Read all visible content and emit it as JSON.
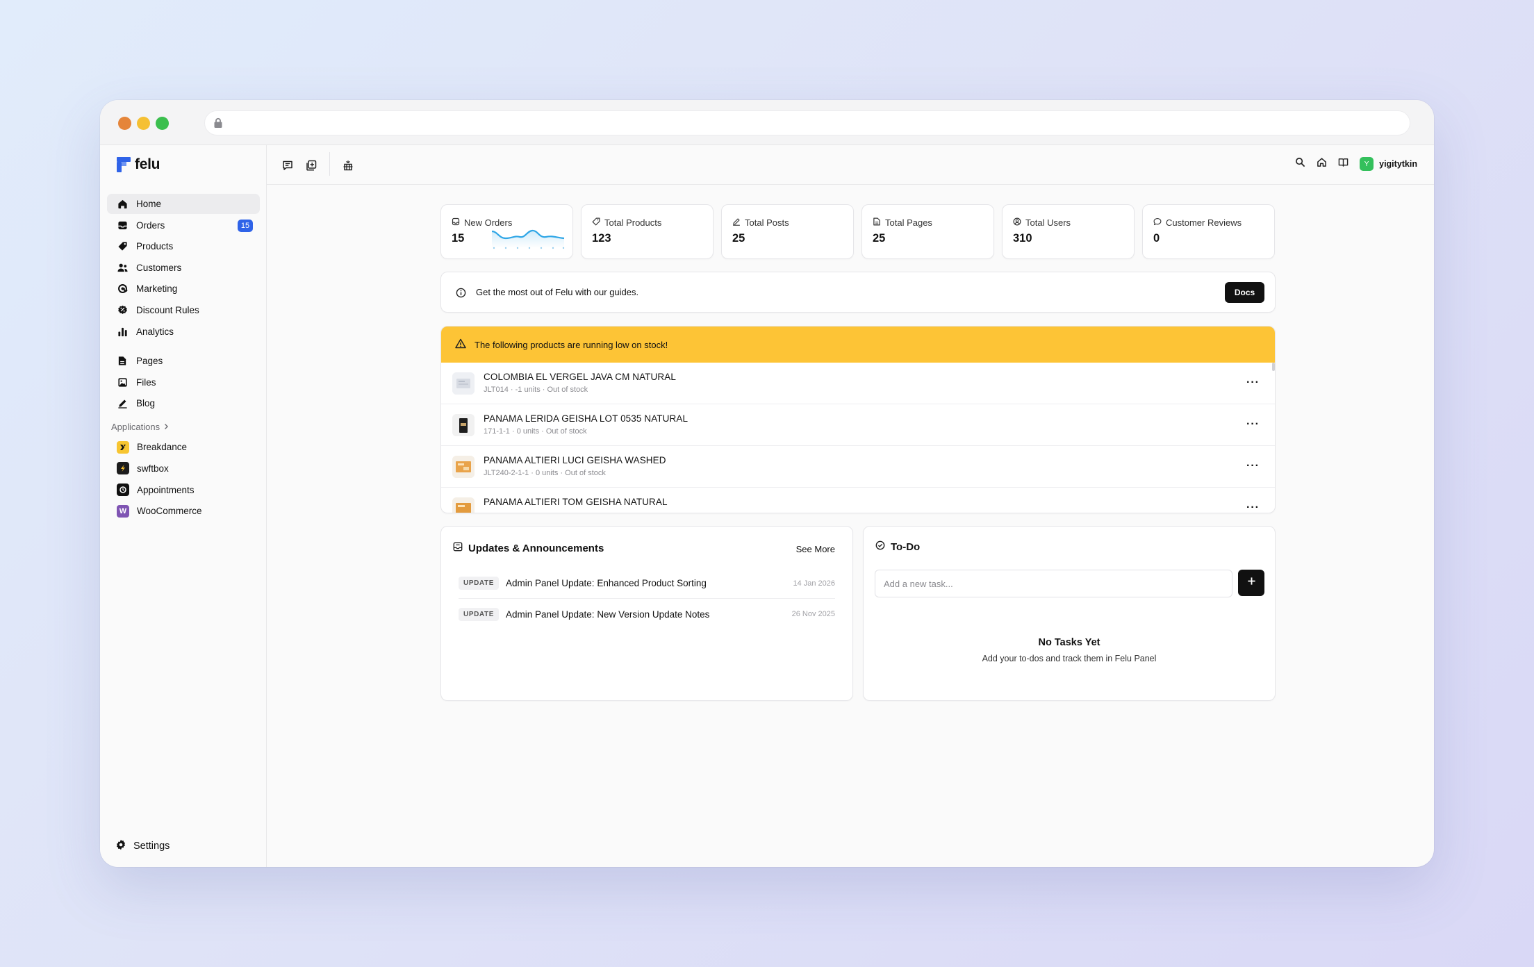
{
  "brand": {
    "name": "felu",
    "accent": "#2f63e8"
  },
  "sidebar": {
    "items": [
      {
        "label": "Home",
        "icon": "home-icon",
        "active": true
      },
      {
        "label": "Orders",
        "icon": "inbox-icon",
        "badge": "15"
      },
      {
        "label": "Products",
        "icon": "tag-icon"
      },
      {
        "label": "Customers",
        "icon": "users-icon"
      },
      {
        "label": "Marketing",
        "icon": "at-icon"
      },
      {
        "label": "Discount Rules",
        "icon": "discount-icon"
      },
      {
        "label": "Analytics",
        "icon": "bar-chart-icon"
      }
    ],
    "content_items": [
      {
        "label": "Pages",
        "icon": "page-icon"
      },
      {
        "label": "Files",
        "icon": "image-icon"
      },
      {
        "label": "Blog",
        "icon": "pen-icon"
      }
    ],
    "applications_label": "Applications",
    "apps": [
      {
        "label": "Breakdance",
        "icon": "breakdance-icon",
        "color": "#f7c531"
      },
      {
        "label": "swftbox",
        "icon": "swftbox-icon",
        "color": "#1c1c1c"
      },
      {
        "label": "Appointments",
        "icon": "appointments-icon",
        "color": "#111111"
      },
      {
        "label": "WooCommerce",
        "icon": "woocommerce-icon",
        "color": "#7f54b3"
      }
    ],
    "settings_label": "Settings"
  },
  "topbar": {
    "username": "yigitytkin",
    "avatar_letter": "Y"
  },
  "stats": [
    {
      "label": "New Orders",
      "value": "15",
      "icon": "inbox-icon"
    },
    {
      "label": "Total Products",
      "value": "123",
      "icon": "tag-icon"
    },
    {
      "label": "Total Posts",
      "value": "25",
      "icon": "pen-icon"
    },
    {
      "label": "Total Pages",
      "value": "25",
      "icon": "page-icon"
    },
    {
      "label": "Total Users",
      "value": "310",
      "icon": "user-circle-icon"
    },
    {
      "label": "Customer Reviews",
      "value": "0",
      "icon": "chat-icon"
    }
  ],
  "guide": {
    "text": "Get the most out of Felu with our guides.",
    "button": "Docs"
  },
  "low_stock": {
    "heading": "The following products are running low on stock!",
    "color": "#fdc436",
    "items": [
      {
        "name": "COLOMBIA EL VERGEL JAVA CM NATURAL",
        "meta": "JLT014 · -1 units · Out of stock"
      },
      {
        "name": "PANAMA LERIDA GEISHA LOT 0535 NATURAL",
        "meta": "171-1-1 · 0 units · Out of stock"
      },
      {
        "name": "PANAMA ALTIERI LUCI GEISHA WASHED",
        "meta": "JLT240-2-1-1 · 0 units · Out of stock"
      },
      {
        "name": "PANAMA ALTIERI TOM GEISHA NATURAL",
        "meta": ""
      }
    ],
    "more": "···"
  },
  "updates": {
    "title": "Updates & Announcements",
    "see_more": "See More",
    "items": [
      {
        "tag": "UPDATE",
        "title": "Admin Panel Update: Enhanced Product Sorting",
        "date": "14 Jan 2026"
      },
      {
        "tag": "UPDATE",
        "title": "Admin Panel Update: New Version Update Notes",
        "date": "26 Nov 2025"
      }
    ]
  },
  "todo": {
    "title": "To-Do",
    "placeholder": "Add a new task...",
    "empty_title": "No Tasks Yet",
    "empty_sub": "Add your to-dos and track them in Felu Panel"
  }
}
